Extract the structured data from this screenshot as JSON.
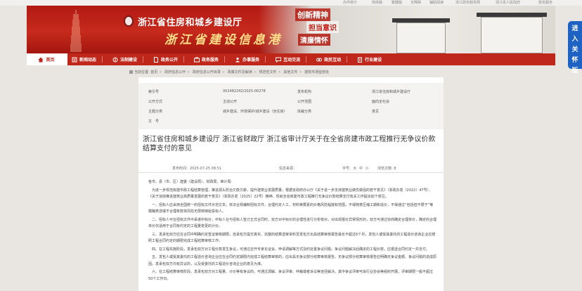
{
  "topbar": {
    "links": [
      "办件统计",
      "简体版",
      "繁體版",
      "无障碍",
      "辅助阅读",
      "浙江政务服务网",
      "浙江省人民政府",
      "政务服务"
    ]
  },
  "header": {
    "site_name": "浙江省住房和城乡建设厅",
    "site_subtitle": "浙江省建设信息港",
    "slogans": [
      "创新精神",
      "担当意识",
      "清廉情怀"
    ]
  },
  "side_badge": {
    "label": "进入关怀版"
  },
  "nav": {
    "items": [
      "首页",
      "新闻动态",
      "法制建设",
      "政务公开",
      "政务服务",
      "办事服务",
      "互动交流",
      "政民互动",
      "行业建设"
    ]
  },
  "breadcrumb": {
    "prefix": "当前位置:",
    "items": [
      "首页",
      "政府信息公开",
      "政府信息公开目录",
      "政策文件及解读",
      "规范性文件",
      "其他文件",
      "建筑市场监管处"
    ]
  },
  "meta": {
    "index_label": "索引号",
    "index_value": "002482242/2025-00278",
    "publisher_label": "发布机构",
    "publisher_value": "浙江省住房和城乡建设厅",
    "disclose_label": "公开方式",
    "disclose_value": "主动公开",
    "scope_label": "公开范围",
    "scope_value": "面向全社会",
    "topic_label": "主题分类",
    "topic_value": "城乡建设、环境保护/城乡建设（含住房）",
    "genre_label": "体裁分类",
    "genre_value": "意见",
    "docno_label": "文　号",
    "docno_value": ""
  },
  "article": {
    "title": "浙江省住房和城乡建设厅 浙江省财政厅 浙江省审计厅关于在全省房建市政工程推行无争议价款结算支付的意见",
    "date_label": "发布时间：2025-07-25 08:51",
    "source_label": "信息来源：",
    "views_label": "浏览次数: 8",
    "text_size_label": "字号:",
    "text_size_options": [
      "大",
      "中",
      "小"
    ],
    "paragraphs": [
      "各市、县（市、区）建委（建设局）、财政局、审计局:",
      "为进一步规范房建市政工程结算管理，推进源头防治欠款欠薪，提升建筑业发展质量，根据省政府办公厅《关于进一步支持建筑业做优做强的若干意见》（浙政办发〔2022〕47号）、《关于加快推进建筑业高质量发展的若干意见》（浙政办发〔2025〕22号）精神，现就全省房建市政工程推行无争议价款结算支付有关工作提出如下意见。",
      "一、招标人应采用全国统一的招标文件示范文本，依法合规编制招标文件，合理约定人工、材料等要素的价格风险幅度和范围，不得随意压缩工期和造价，不得通过“包括但不限于”等模糊表述或不合理条款将风险无限转嫁给投标人。",
      "二、招标人可在招标文件中承诺中标价，中标人在与招标人签订正式合同时，双方对中标价的合理性进行分析核对，对出现报价异常情形的，双方可通过协商确定合理单价，确定的合理单价仅适用于合同有约定的工程量变更的计价。",
      "三、发承包双方应在合同中明确约定签证审核期限，自承包方提交真实、完整的结算送审资料至发包方出具结算审核报告最长不超过6个月，发包人或受其委托的工程造价咨询企业应按照工程合同约定的期限完成工程结算审核工作。",
      "四、在工程实施阶段，发承包双方对工程价款发生争议，可通过召开专家论证会、申请调解等方式及时处置争议问题。争议问题解决后确定的工程价款，应报送合同约定一并支付。",
      "五、发包人或受其委托的工程造价咨询企业应在合同约定期限内完成工程结算审核的，应出具无争议部分结算审核报告。无争议部分结算审核报告应明确无争议金额、争议问题的造成原因。发承包双方均有异议的，以及受委托的工程造价咨询企业的意见为准。",
      "六、在工程结算审核阶段，发承包双方对工程量、计价等有争议的，可通过调解、争议评审、仲裁或者诉讼等途径解决。其中争议评审可由行业协会等组织开展，评审期限一般不超过50个工作日。"
    ]
  },
  "colors": {
    "brand_red": "#c0271b",
    "banner_red": "#b31a14",
    "side_badge_blue": "#1e63c4",
    "gold": "#ffe08a"
  }
}
